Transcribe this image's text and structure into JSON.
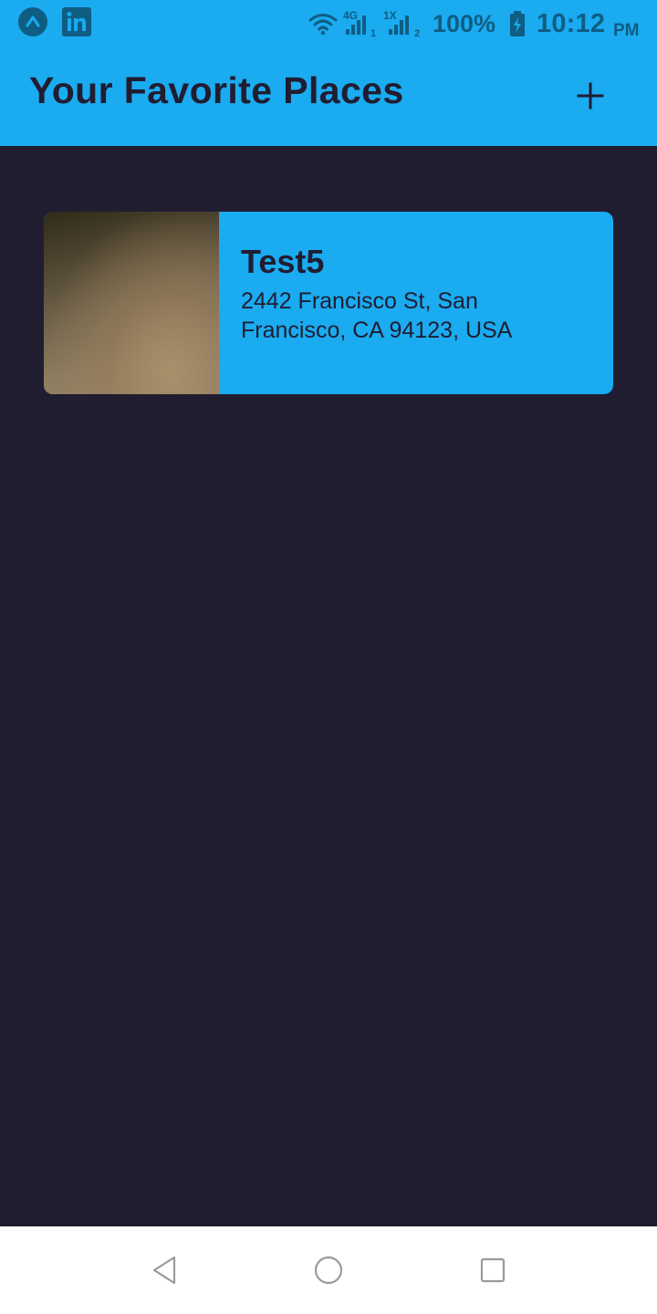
{
  "status_bar": {
    "network_4g": "4G",
    "network_sim1": "1",
    "network_1x": "1X",
    "network_sim2": "2",
    "battery": "100%",
    "time": "10:12",
    "ampm": "PM",
    "icons": [
      "app-a-icon",
      "linkedin-icon",
      "wifi-icon",
      "signal-icon",
      "battery-icon"
    ]
  },
  "app_bar": {
    "title": "Your Favorite Places",
    "add_icon": "plus-icon"
  },
  "places": [
    {
      "title": "Test5",
      "address": "2442 Francisco St, San Francisco, CA 94123, USA"
    }
  ],
  "nav_bar": {
    "icons": [
      "back-icon",
      "home-icon",
      "recent-apps-icon"
    ]
  },
  "colors": {
    "accent": "#1aabf0",
    "background": "#211d31",
    "text_dark": "#211d31",
    "status_icons": "#0f5d83"
  }
}
